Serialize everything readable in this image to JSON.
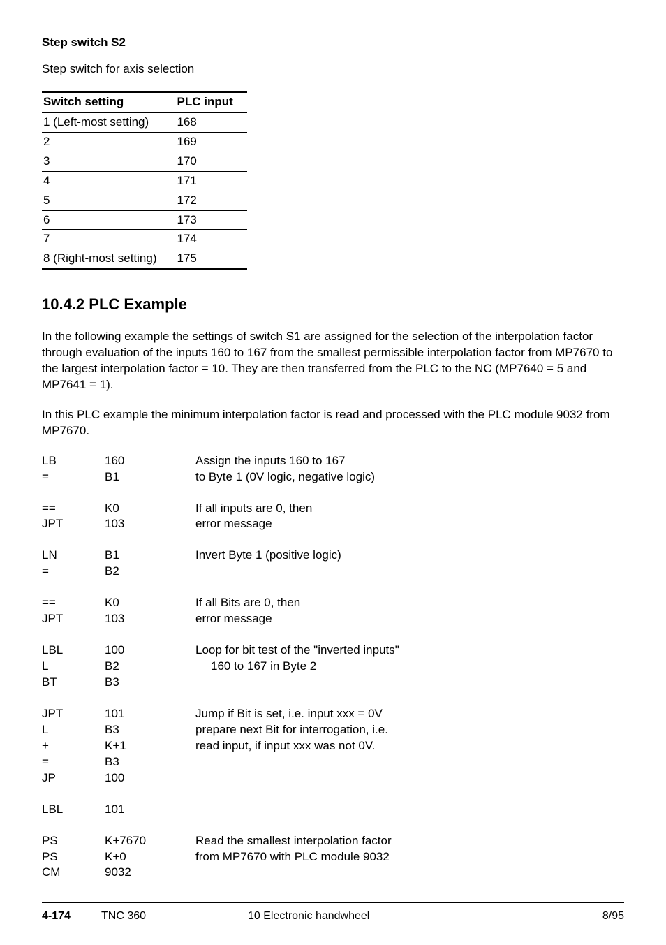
{
  "header": {
    "title": "Step switch S2",
    "subtitle": "Step switch for axis selection"
  },
  "table": {
    "h1": "Switch setting",
    "h2": "PLC input",
    "rows": [
      {
        "c1": "1 (Left-most setting)",
        "c2": "168"
      },
      {
        "c1": "2",
        "c2": "169"
      },
      {
        "c1": "3",
        "c2": "170"
      },
      {
        "c1": "4",
        "c2": "171"
      },
      {
        "c1": "5",
        "c2": "172"
      },
      {
        "c1": "6",
        "c2": "173"
      },
      {
        "c1": "7",
        "c2": "174"
      },
      {
        "c1": "8 (Right-most setting)",
        "c2": "175"
      }
    ]
  },
  "section": {
    "heading": "10.4.2  PLC Example",
    "p1": "In the following example the settings of switch S1 are assigned for the selection of the interpolation factor through evaluation of the inputs  160 to  167 from the smallest permissible interpolation factor from MP7670 to the largest interpolation factor = 10.  They are then transferred from the PLC to the NC (MP7640 = 5 and MP7641 = 1).",
    "p2": "In this PLC example the minimum interpolation factor is read and processed with the PLC module 9032 from MP7670."
  },
  "code": [
    {
      "c1": "LB",
      "c2": "160",
      "c3": "Assign the inputs  160 to  167"
    },
    {
      "c1": "=",
      "c2": "B1",
      "c3": "to Byte 1 (0V logic, negative logic)"
    },
    {
      "gap": true
    },
    {
      "c1": "==",
      "c2": "K0",
      "c3": "If all inputs are 0, then"
    },
    {
      "c1": "JPT",
      "c2": "103",
      "c3": "error message"
    },
    {
      "gap": true
    },
    {
      "c1": "LN",
      "c2": "B1",
      "c3": "Invert Byte 1 (positive logic)"
    },
    {
      "c1": "=",
      "c2": "B2",
      "c3": ""
    },
    {
      "gap": true
    },
    {
      "c1": "==",
      "c2": "K0",
      "c3": "If all Bits are 0, then"
    },
    {
      "c1": "JPT",
      "c2": "103",
      "c3": "error message"
    },
    {
      "gap": true
    },
    {
      "c1": "LBL",
      "c2": "100",
      "c3": "Loop for bit test of the \"inverted inputs\""
    },
    {
      "c1": "L",
      "c2": "B2",
      "c3": " 160 to  167 in Byte 2",
      "indent": true
    },
    {
      "c1": "BT",
      "c2": "B3",
      "c3": ""
    },
    {
      "gap": true
    },
    {
      "c1": "JPT",
      "c2": "101",
      "c3": "Jump if Bit is set, i.e. input  xxx = 0V"
    },
    {
      "c1": "L",
      "c2": "B3",
      "c3": "prepare next Bit for interrogation, i.e."
    },
    {
      "c1": "+",
      "c2": "K+1",
      "c3": "read input, if input  xxx was not 0V."
    },
    {
      "c1": "=",
      "c2": "B3",
      "c3": ""
    },
    {
      "c1": "JP",
      "c2": "100",
      "c3": ""
    },
    {
      "gap": true
    },
    {
      "c1": "LBL",
      "c2": "101",
      "c3": ""
    },
    {
      "gap": true
    },
    {
      "c1": "PS",
      "c2": "K+7670",
      "c3": "Read the smallest interpolation factor"
    },
    {
      "c1": "PS",
      "c2": "K+0",
      "c3": "from MP7670 with PLC module 9032"
    },
    {
      "c1": "CM",
      "c2": "9032",
      "c3": ""
    }
  ],
  "footer": {
    "page": "4-174",
    "model": "TNC 360",
    "section": "10  Electronic handwheel",
    "date": "8/95"
  }
}
